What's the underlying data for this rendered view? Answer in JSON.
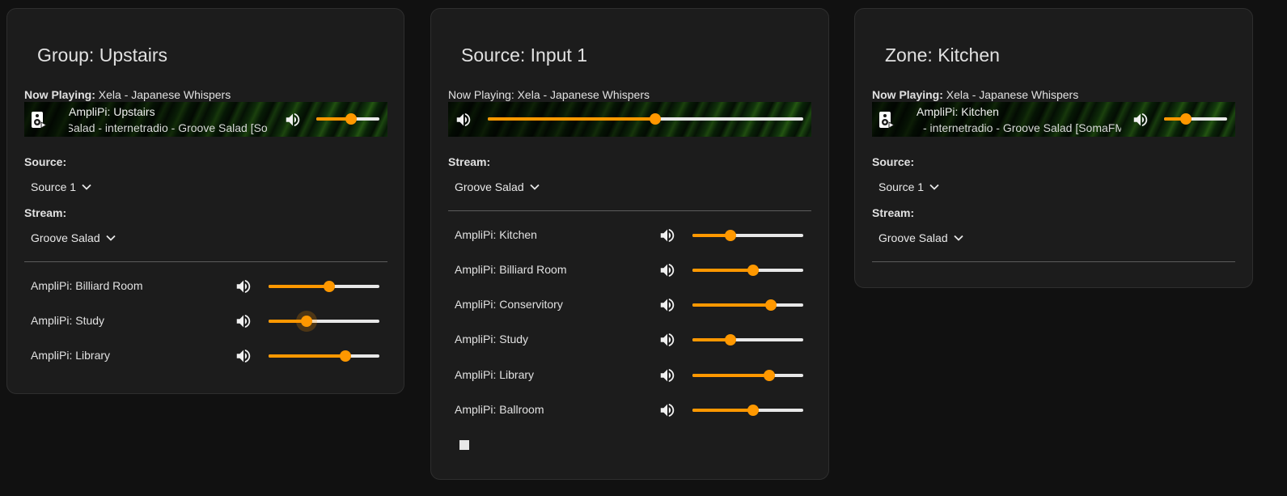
{
  "accent_color": "#ff9800",
  "group_card": {
    "title": "Group: Upstairs",
    "now_playing_label": "Now Playing:",
    "now_playing_value": "Xela - Japanese Whispers",
    "player": {
      "thumb_icon": "speaker-icon",
      "title": "AmpliPi: Upstairs",
      "subtitle": "ve Salad - internetradio - Groove Salad [So",
      "volume_fraction": 0.55
    },
    "source_label": "Source:",
    "source_value": "Source 1",
    "stream_label": "Stream:",
    "stream_value": "Groove Salad",
    "zones": [
      {
        "name": "AmpliPi: Billiard Room",
        "volume_fraction": 0.55
      },
      {
        "name": "AmpliPi: Study",
        "volume_fraction": 0.34
      },
      {
        "name": "AmpliPi: Library",
        "volume_fraction": 0.69
      }
    ]
  },
  "source_card": {
    "title": "Source: Input 1",
    "now_playing_label": "Now Playing:",
    "now_playing_value": "Xela - Japanese Whispers",
    "player": {
      "volume_fraction": 0.53
    },
    "stream_label": "Stream:",
    "stream_value": "Groove Salad",
    "zones": [
      {
        "name": "AmpliPi: Kitchen",
        "volume_fraction": 0.34
      },
      {
        "name": "AmpliPi: Billiard Room",
        "volume_fraction": 0.55
      },
      {
        "name": "AmpliPi: Conservitory",
        "volume_fraction": 0.71
      },
      {
        "name": "AmpliPi: Study",
        "volume_fraction": 0.34
      },
      {
        "name": "AmpliPi: Library",
        "volume_fraction": 0.69
      },
      {
        "name": "AmpliPi: Ballroom",
        "volume_fraction": 0.55
      }
    ]
  },
  "zone_card": {
    "title": "Zone: Kitchen",
    "now_playing_label": "Now Playing:",
    "now_playing_value": "Xela - Japanese Whispers",
    "player": {
      "thumb_icon": "speaker-icon",
      "title": "AmpliPi: Kitchen",
      "subtitle": "- internetradio - Groove Salad [SomaFM]",
      "volume_fraction": 0.34
    },
    "source_label": "Source:",
    "source_value": "Source 1",
    "stream_label": "Stream:",
    "stream_value": "Groove Salad"
  }
}
